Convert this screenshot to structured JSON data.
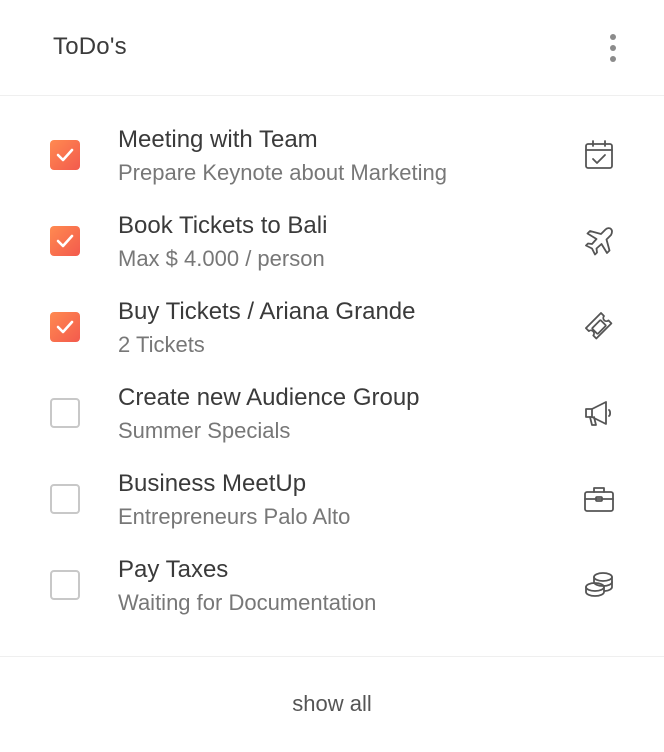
{
  "header": {
    "title": "ToDo's",
    "menu_icon": "more-vertical-icon"
  },
  "accent_gradient": [
    "#ff8a50",
    "#f35a4d"
  ],
  "todos": [
    {
      "title": "Meeting with Team",
      "subtitle": "Prepare Keynote about Marketing",
      "checked": true,
      "icon": "calendar-check-icon"
    },
    {
      "title": "Book Tickets to Bali",
      "subtitle": "Max $ 4.000 / person",
      "checked": true,
      "icon": "airplane-icon"
    },
    {
      "title": "Buy Tickets / Ariana Grande",
      "subtitle": "2 Tickets",
      "checked": true,
      "icon": "ticket-icon"
    },
    {
      "title": "Create new Audience Group",
      "subtitle": "Summer Specials",
      "checked": false,
      "icon": "megaphone-icon"
    },
    {
      "title": "Business MeetUp",
      "subtitle": "Entrepreneurs Palo Alto",
      "checked": false,
      "icon": "briefcase-icon"
    },
    {
      "title": "Pay Taxes",
      "subtitle": "Waiting for Documentation",
      "checked": false,
      "icon": "coins-icon"
    }
  ],
  "footer": {
    "show_all_label": "show all"
  }
}
